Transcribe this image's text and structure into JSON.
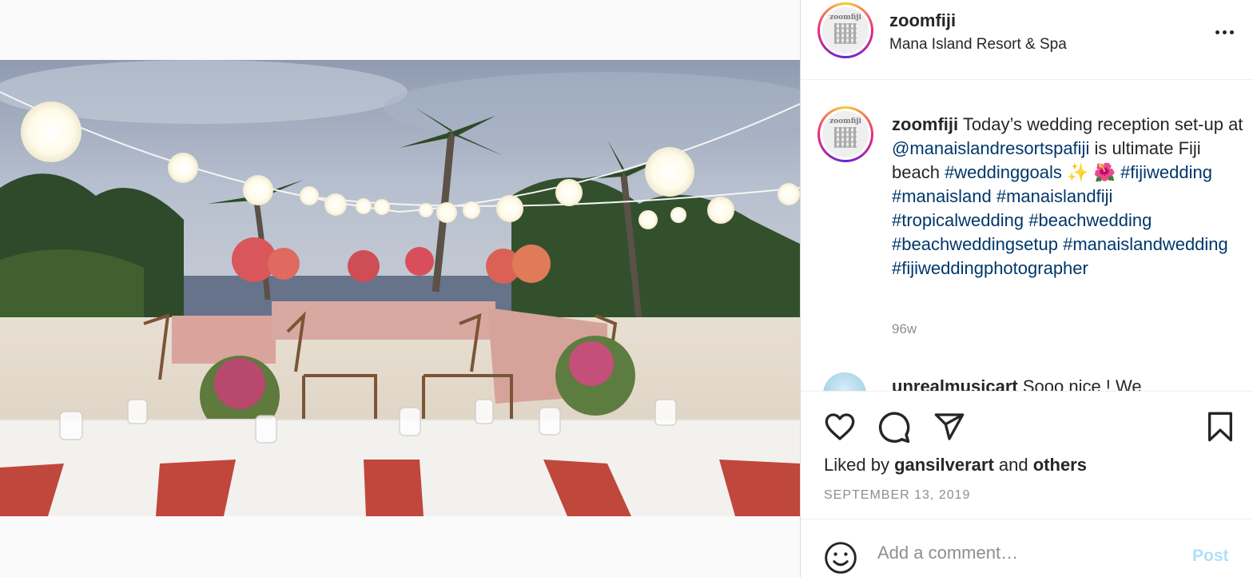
{
  "post": {
    "username": "zoomfiji",
    "location": "Mana Island Resort & Spa",
    "avatar_logo_text": "zoomfiji"
  },
  "caption": {
    "username": "zoomfiji",
    "text_1": " Today’s wedding reception set-up at ",
    "mention": "@manaislandresortspafiji",
    "text_2": " is ultimate Fiji beach ",
    "tag_1": "#weddinggoals",
    "emoji": " ✨ 🌺 ",
    "tag_2": "#fijiwedding",
    "tag_3": "#manaisland",
    "tag_4": "#manaislandfiji",
    "tag_5": "#tropicalwedding",
    "tag_6": "#beachwedding",
    "tag_7": "#beachweddingsetup",
    "tag_8": "#manaislandwedding",
    "tag_9": "#fijiweddingphotographer",
    "time_ago": "96w"
  },
  "next_comment": {
    "username": "unrealmusicart",
    "text": " Sooo nice ! We"
  },
  "actions": {
    "liked_by_prefix": "Liked by ",
    "liked_by_user": "gansilverart",
    "liked_by_and": " and ",
    "liked_by_others": "others",
    "date": "SEPTEMBER 13, 2019"
  },
  "comment_box": {
    "placeholder": "Add a comment…",
    "post_label": "Post"
  },
  "icons": [
    "more-options-icon",
    "heart-icon",
    "comment-icon",
    "share-icon",
    "bookmark-icon",
    "emoji-icon"
  ],
  "colors": {
    "link": "#00376b",
    "muted": "#8e8e8e",
    "post_disabled": "#b2dffc"
  }
}
